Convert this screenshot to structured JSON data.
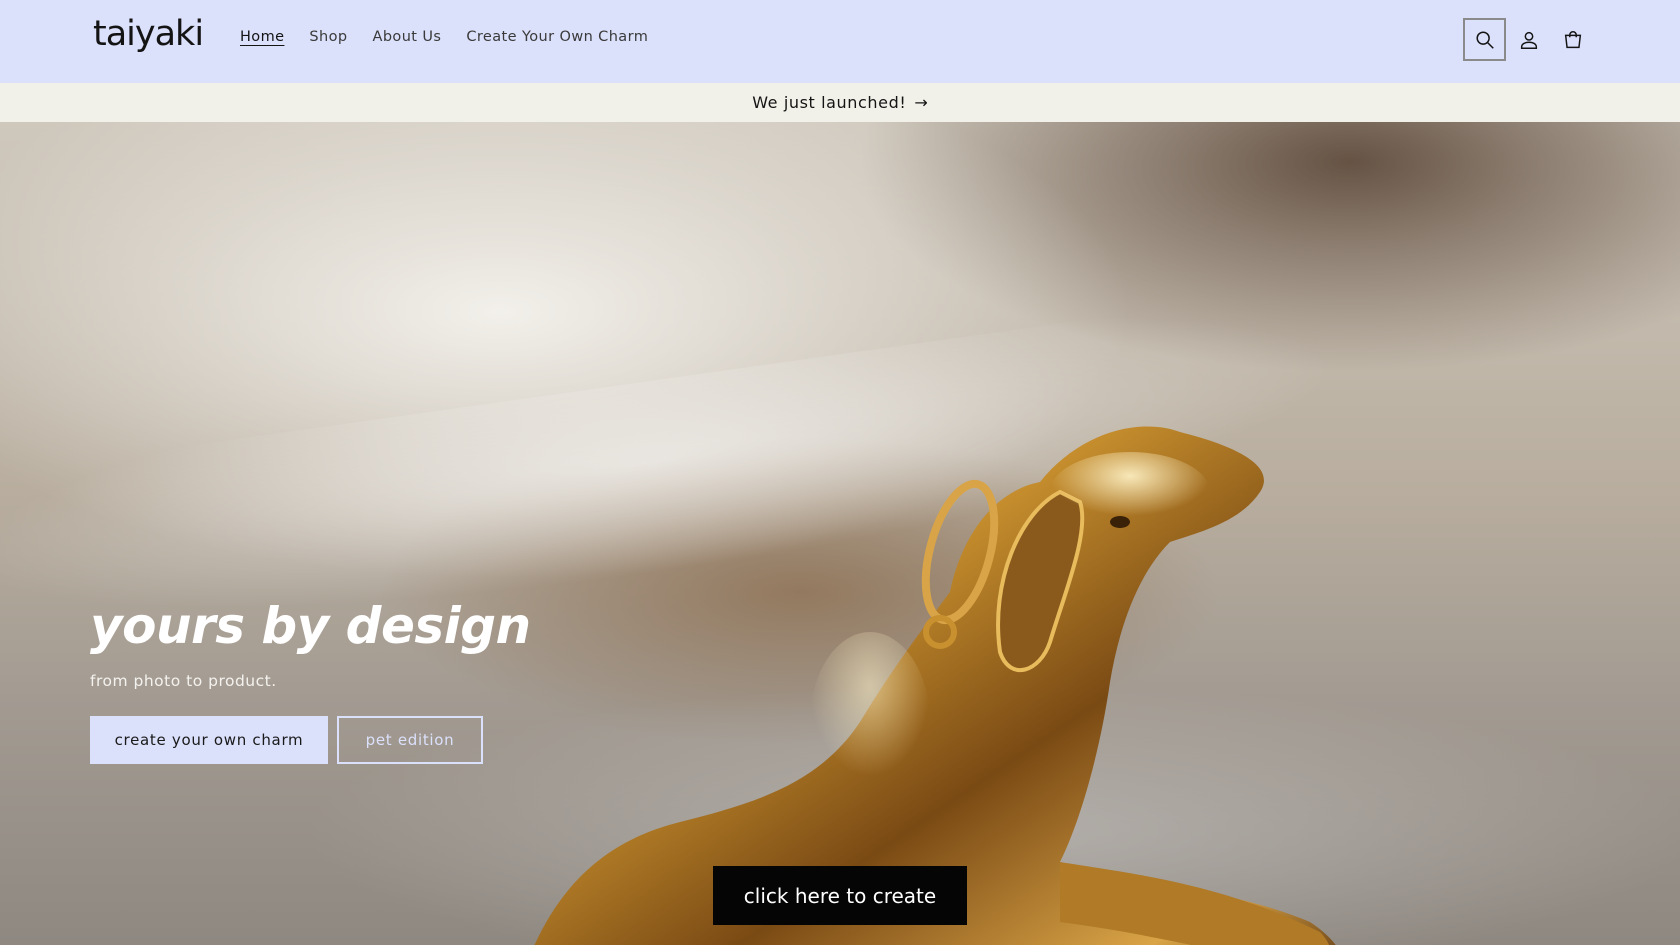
{
  "header": {
    "logo": "taiyaki",
    "nav": [
      "Home",
      "Shop",
      "About Us",
      "Create Your Own Charm"
    ],
    "active_nav": "Home",
    "icons": [
      "search-icon",
      "account-icon",
      "cart-icon"
    ]
  },
  "announcement": {
    "text": "We just launched!",
    "arrow": "→"
  },
  "hero": {
    "title": "yours by design",
    "subtitle": "from photo to product.",
    "primary_button": "create your own charm",
    "secondary_button": "pet edition",
    "create_button": "click here to create"
  },
  "colors": {
    "header_bg": "#dbe0fb",
    "announcement_bg": "#f2f1e9",
    "create_button_bg": "#050505",
    "gold": "#c8902e"
  }
}
